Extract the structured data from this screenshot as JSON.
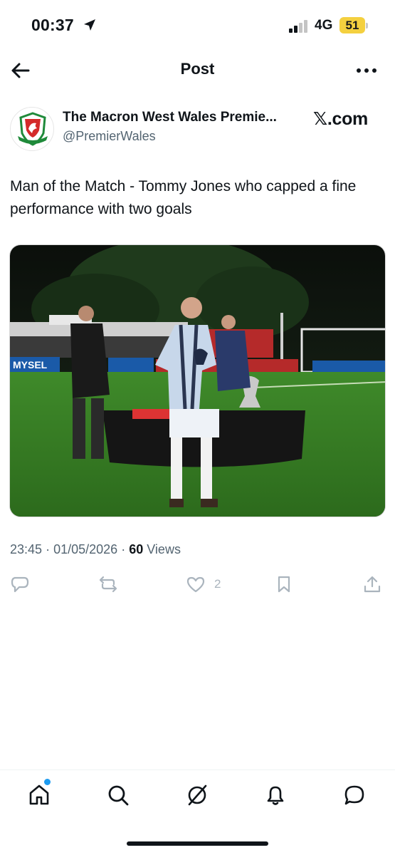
{
  "status_bar": {
    "time": "00:37",
    "network": "4G",
    "battery": "51",
    "battery_color": "#f4d03f"
  },
  "header": {
    "title": "Post",
    "back_icon": "arrow-left-icon",
    "more_icon": "more-horizontal-icon"
  },
  "post": {
    "author_name": "The Macron West Wales Premie...",
    "author_handle": "@PremierWales",
    "source": "𝕏.com",
    "text": "Man of the Match - Tommy Jones who capped a fine performance with two goals",
    "image_alt": "Player holding Man of the Match trophy on a floodlit pitch beside a trophy table",
    "meta": {
      "time": "23:45",
      "separator": "·",
      "date": "01/05/2026",
      "views_count": "60",
      "views_label": "Views"
    },
    "actions": {
      "like_count": "2"
    }
  },
  "bottom_nav": {
    "items": [
      "home-icon",
      "search-icon",
      "grok-icon",
      "notifications-icon",
      "messages-icon"
    ]
  },
  "colors": {
    "text": "#0f1419",
    "secondary": "#536471",
    "accent": "#1d9bf0",
    "action_icons": "#aab4bd"
  }
}
